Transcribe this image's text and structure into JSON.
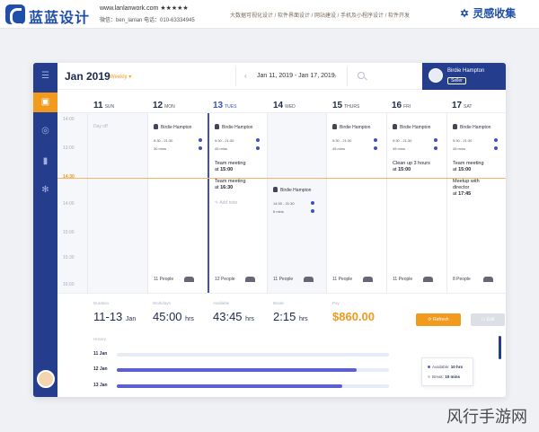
{
  "banner": {
    "brand_name": "蓝蓝设计",
    "site": "www.lanlanwork.com",
    "stars": "★★★★★",
    "contact": "微信：ben_lanlan    电话：010-63334945",
    "links": "大数据可视化设计 / 软件界面设计 / 网站建设 / 手机及小程序设计 / 软件开发",
    "right_logo": "灵感收集"
  },
  "header": {
    "month": "Jan 2019",
    "view_mode": "Weekly ▾",
    "range": "Jan 11, 2019 - Jan 17, 2019",
    "prev": "‹",
    "next": "›",
    "user_name": "Birdie Hampton",
    "user_role": "Seller"
  },
  "rail": {
    "items": [
      "menu-icon",
      "calendar-icon",
      "target-icon",
      "chart-icon",
      "gear-icon"
    ]
  },
  "days": [
    {
      "num": "11",
      "name": "SUN"
    },
    {
      "num": "12",
      "name": "MON"
    },
    {
      "num": "13",
      "name": "TUES"
    },
    {
      "num": "14",
      "name": "WED"
    },
    {
      "num": "15",
      "name": "THURS"
    },
    {
      "num": "16",
      "name": "FRI"
    },
    {
      "num": "17",
      "name": "SAT"
    }
  ],
  "times": [
    "14:00",
    "13:00",
    "14:30",
    "14:00",
    "15:00",
    "15:30",
    "16:00"
  ],
  "events": {
    "sun_dayoff": "Day off",
    "person": "Birdie Hampton",
    "time_range": "9:30 - 21:30",
    "duration": "30 mins",
    "duration_45": "45 mins",
    "wed_time_range": "14:30 - 21:30",
    "wed_duration": "6 mins",
    "tue_note1_a": "Team meeting",
    "tue_note1_b": "at",
    "tue_note1_time": "15:00",
    "tue_note2_a": "Team meeting",
    "tue_note2_b": "at",
    "tue_note2_time": "16:30",
    "tue_add": "Add note",
    "fri_note_a": "Clean up 3 hours",
    "fri_note_b": "at",
    "fri_note_time": "15:00",
    "sat_note1_a": "Team meeting",
    "sat_note1_b": "at",
    "sat_note1_time": "15:00",
    "sat_note2_a": "Meetup with",
    "sat_note2_b": "director",
    "sat_note2_c": "at",
    "sat_note2_time": "17:45",
    "people_11": "11 People",
    "people_12": "12 People",
    "people_8": "8 People"
  },
  "summary": {
    "labels": [
      "Duration",
      "Workdays",
      "Available",
      "Break",
      "Pay"
    ],
    "dates": "11-13",
    "dates_unit": "Jan",
    "hours": "45:00",
    "hours_unit": "hrs",
    "available": "43:45",
    "available_unit": "hrs",
    "break": "2:15",
    "break_unit": "hrs",
    "pay": "$860.00",
    "refresh_label": "Refresh",
    "edit_label": "Edit"
  },
  "history": {
    "title": "History",
    "rows": [
      {
        "label": "11 Jan",
        "fill": 0.0
      },
      {
        "label": "12 Jan",
        "fill": 0.88
      },
      {
        "label": "13 Jan",
        "fill": 0.83
      }
    ],
    "tooltip": {
      "available_label": "Available:",
      "available_value": "10 hrs",
      "break_label": "Break:",
      "break_value": "10 mins"
    }
  },
  "colors": {
    "brand": "#243d8c",
    "accent": "#f29a1e",
    "bar": "#5b5fcf"
  },
  "watermark": "风行手游网"
}
